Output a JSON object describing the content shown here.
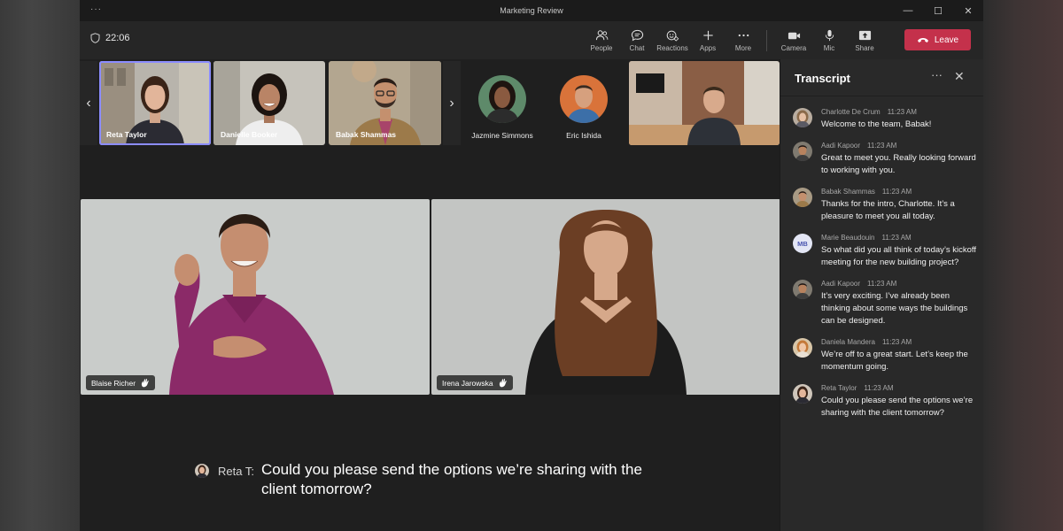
{
  "window": {
    "title": "Marketing Review",
    "menu_glyph": "···",
    "controls": [
      "—",
      "☐",
      "✕"
    ]
  },
  "toolbar": {
    "timer": "22:06",
    "tools": [
      {
        "label": "People",
        "icon": "people-icon"
      },
      {
        "label": "Chat",
        "icon": "chat-icon"
      },
      {
        "label": "Reactions",
        "icon": "reactions-icon"
      },
      {
        "label": "Apps",
        "icon": "plus-icon"
      },
      {
        "label": "More",
        "icon": "more-icon"
      },
      {
        "label": "Camera",
        "icon": "camera-icon"
      },
      {
        "label": "Mic",
        "icon": "mic-icon"
      },
      {
        "label": "Share",
        "icon": "share-icon"
      }
    ],
    "leave_label": "Leave",
    "leave_color": "#c4314b"
  },
  "strip": {
    "prev_glyph": "‹",
    "next_glyph": "›",
    "participants": [
      "Reta Taylor",
      "Danielle Booker",
      "Babak Shammas",
      "Jazmine Simmons",
      "Eric Ishida"
    ]
  },
  "stage": {
    "left_name": "Blaise Richer",
    "right_name": "Irena Jarowska"
  },
  "caption": {
    "speaker": "Reta T:",
    "text": "Could you please send the options we’re sharing with the client tomorrow?"
  },
  "transcript": {
    "title": "Transcript",
    "more_glyph": "···",
    "close_glyph": "✕",
    "entries": [
      {
        "name": "Charlotte De Crum",
        "time": "11:23 AM",
        "text": "Welcome to the team, Babak!"
      },
      {
        "name": "Aadi Kapoor",
        "time": "11:23 AM",
        "text": "Great to meet you. Really looking forward to working with you."
      },
      {
        "name": "Babak Shammas",
        "time": "11:23 AM",
        "text": "Thanks for the intro, Charlotte. It’s a pleasure to meet you all today."
      },
      {
        "name": "Marie Beaudouin",
        "time": "11:23 AM",
        "initials": "MB",
        "text": "So what did you all think of today’s kickoff meeting for the new building project?"
      },
      {
        "name": "Aadi Kapoor",
        "time": "11:23 AM",
        "text": "It’s very exciting. I’ve already been thinking about some ways the buildings can be designed."
      },
      {
        "name": "Daniela Mandera",
        "time": "11:23 AM",
        "text": "We’re off to a great start. Let’s keep the momentum going."
      },
      {
        "name": "Reta Taylor",
        "time": "11:23 AM",
        "text": "Could you please send the options we’re sharing with the client tomorrow?"
      }
    ]
  }
}
